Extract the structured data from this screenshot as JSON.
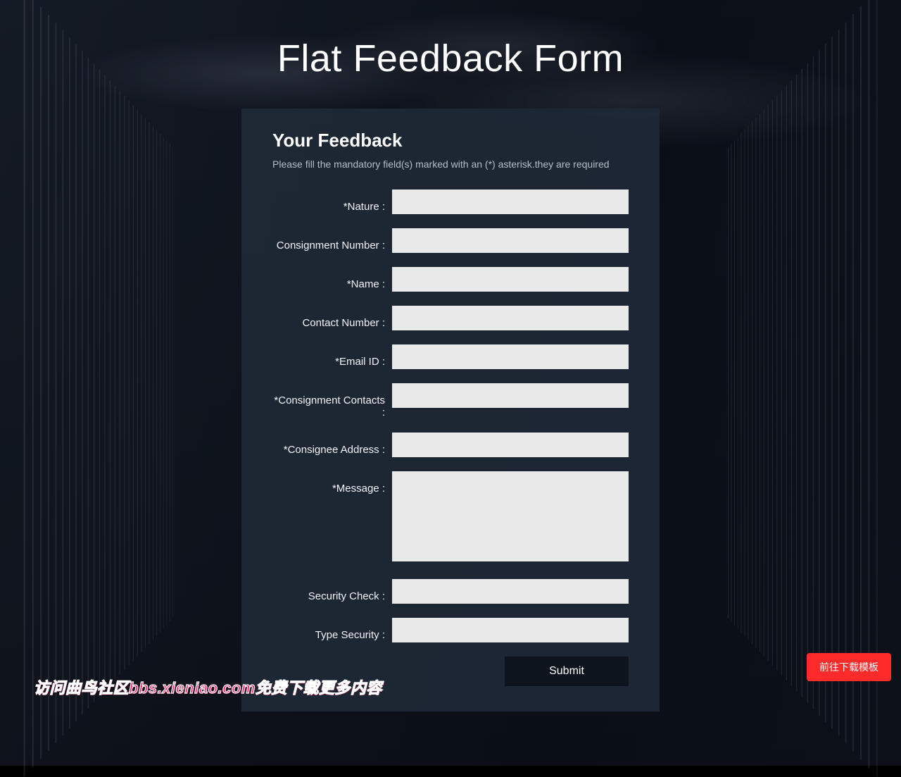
{
  "page_title": "Flat Feedback Form",
  "card": {
    "heading": "Your Feedback",
    "hint": "Please fill the mandatory field(s) marked with an (*) asterisk.they are required"
  },
  "fields": {
    "nature": {
      "label": "*Nature :",
      "value": ""
    },
    "consignment_no": {
      "label": "Consignment Number :",
      "value": ""
    },
    "name": {
      "label": "*Name :",
      "value": ""
    },
    "contact_no": {
      "label": "Contact Number :",
      "value": ""
    },
    "email": {
      "label": "*Email ID :",
      "value": ""
    },
    "cons_contacts": {
      "label": "*Consignment Contacts :",
      "value": ""
    },
    "cons_address": {
      "label": "*Consignee Address :",
      "value": ""
    },
    "message": {
      "label": "*Message :",
      "value": ""
    },
    "security_check": {
      "label": "Security Check :",
      "value": ""
    },
    "type_security": {
      "label": "Type Security :",
      "value": ""
    }
  },
  "buttons": {
    "submit": "Submit",
    "download_template": "前往下载模板"
  },
  "watermark": "访问曲鸟社区bbs.xieniao.com免费下载更多内容"
}
